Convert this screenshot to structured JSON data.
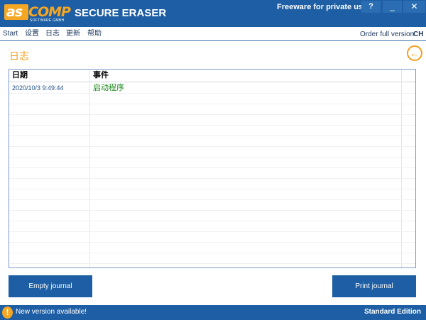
{
  "titlebar": {
    "logo_as": "as",
    "logo_comp": "COMP",
    "logo_sub": "SOFTWARE GMBH",
    "app_title": "SECURE ERASER",
    "freeware": "Freeware for private use",
    "help_label": "?",
    "minimize_label": "_",
    "close_label": "✕"
  },
  "menu": {
    "items": [
      "Start",
      "设置",
      "日志",
      "更新",
      "帮助"
    ],
    "order_label": "Order full version",
    "lang_label": "CH"
  },
  "page": {
    "title": "日志",
    "back_icon": "arrow-left-circle-icon"
  },
  "journal": {
    "columns": [
      "日期",
      "事件"
    ],
    "rows": [
      {
        "date": "2020/10/3 9:49:44",
        "event": "启动程序"
      }
    ]
  },
  "buttons": {
    "empty_label": "Empty journal",
    "print_label": "Print journal"
  },
  "statusbar": {
    "new_version": "New version available!",
    "edition": "Standard Edition"
  },
  "colors": {
    "brand_blue": "#1d5ea4",
    "accent_orange": "#f5a623",
    "event_green": "#1a8a1a"
  }
}
